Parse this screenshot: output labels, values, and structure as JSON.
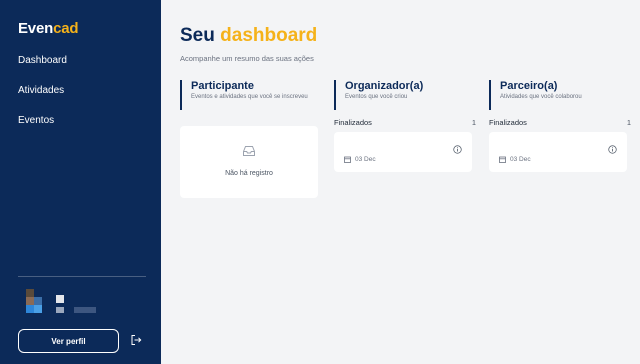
{
  "sidebar": {
    "brand_prefix": "Even",
    "brand_suffix": "cad",
    "nav": [
      "Dashboard",
      "Atividades",
      "Eventos"
    ],
    "profile_button": "Ver perfil",
    "logout_icon": "logout-icon"
  },
  "main": {
    "title_prefix": "Seu",
    "title_highlight": "dashboard",
    "subtitle": "Acompanhe um resumo das suas ações",
    "sections": [
      {
        "title": "Participante",
        "description": "Eventos e atividades que você se inscreveu",
        "empty_text": "Não há registro"
      },
      {
        "title": "Organizador(a)",
        "description": "Eventos que você criou",
        "list_label": "Finalizados",
        "list_count": "1",
        "event_date": "03 Dec"
      },
      {
        "title": "Parceiro(a)",
        "description": "Atividades que você colaborou",
        "list_label": "Finalizados",
        "list_count": "1",
        "event_date": "03 Dec"
      }
    ]
  },
  "colors": {
    "sidebar_bg": "#0c2a59",
    "accent": "#f5b21a",
    "page_bg": "#f3f4f6"
  }
}
